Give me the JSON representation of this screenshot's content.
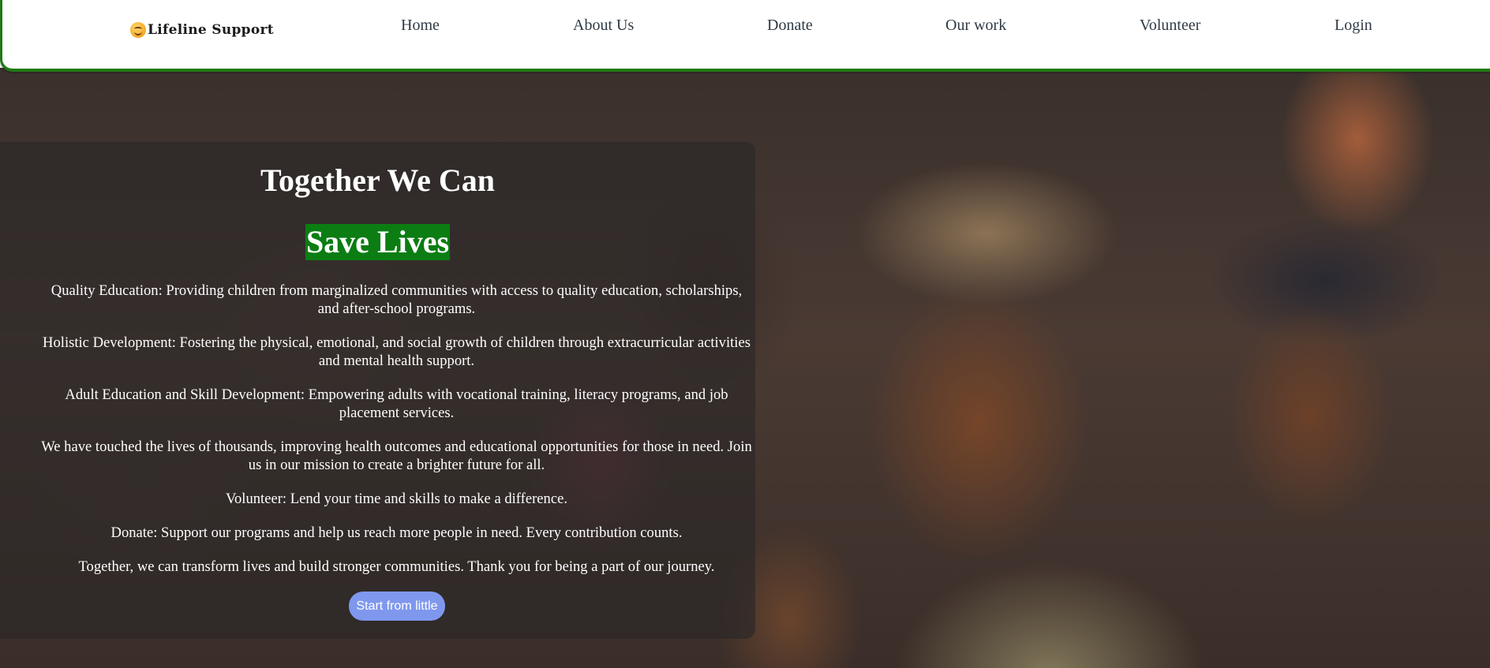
{
  "brand": {
    "name": "Lifeline Support",
    "icon": "smiling-face-icon"
  },
  "nav": {
    "home": "Home",
    "about": "About Us",
    "donate": "Donate",
    "work": "Our work",
    "volunteer": "Volunteer",
    "login": "Login"
  },
  "hero": {
    "title": "Together We Can",
    "highlight": "Save Lives",
    "paragraphs": [
      "Quality Education: Providing children from marginalized communities with access to quality education, scholarships, and after-school programs.",
      "Holistic Development: Fostering the physical, emotional, and social growth of children through extracurricular activities and mental health support.",
      "Adult Education and Skill Development: Empowering adults with vocational training, literacy programs, and job placement services.",
      "We have touched the lives of thousands, improving health outcomes and educational opportunities for those in need. Join us in our mission to create a brighter future for all.",
      "Volunteer: Lend your time and skills to make a difference.",
      "Donate: Support our programs and help us reach more people in need. Every contribution counts.",
      "Together, we can transform lives and build stronger communities. Thank you for being a part of our journey."
    ],
    "cta": "Start from little"
  },
  "colors": {
    "nav_border": "#1f7a12",
    "highlight_bg": "#0b7d13",
    "button_bg": "#7f98ee",
    "nav_text": "#2f3a44"
  }
}
